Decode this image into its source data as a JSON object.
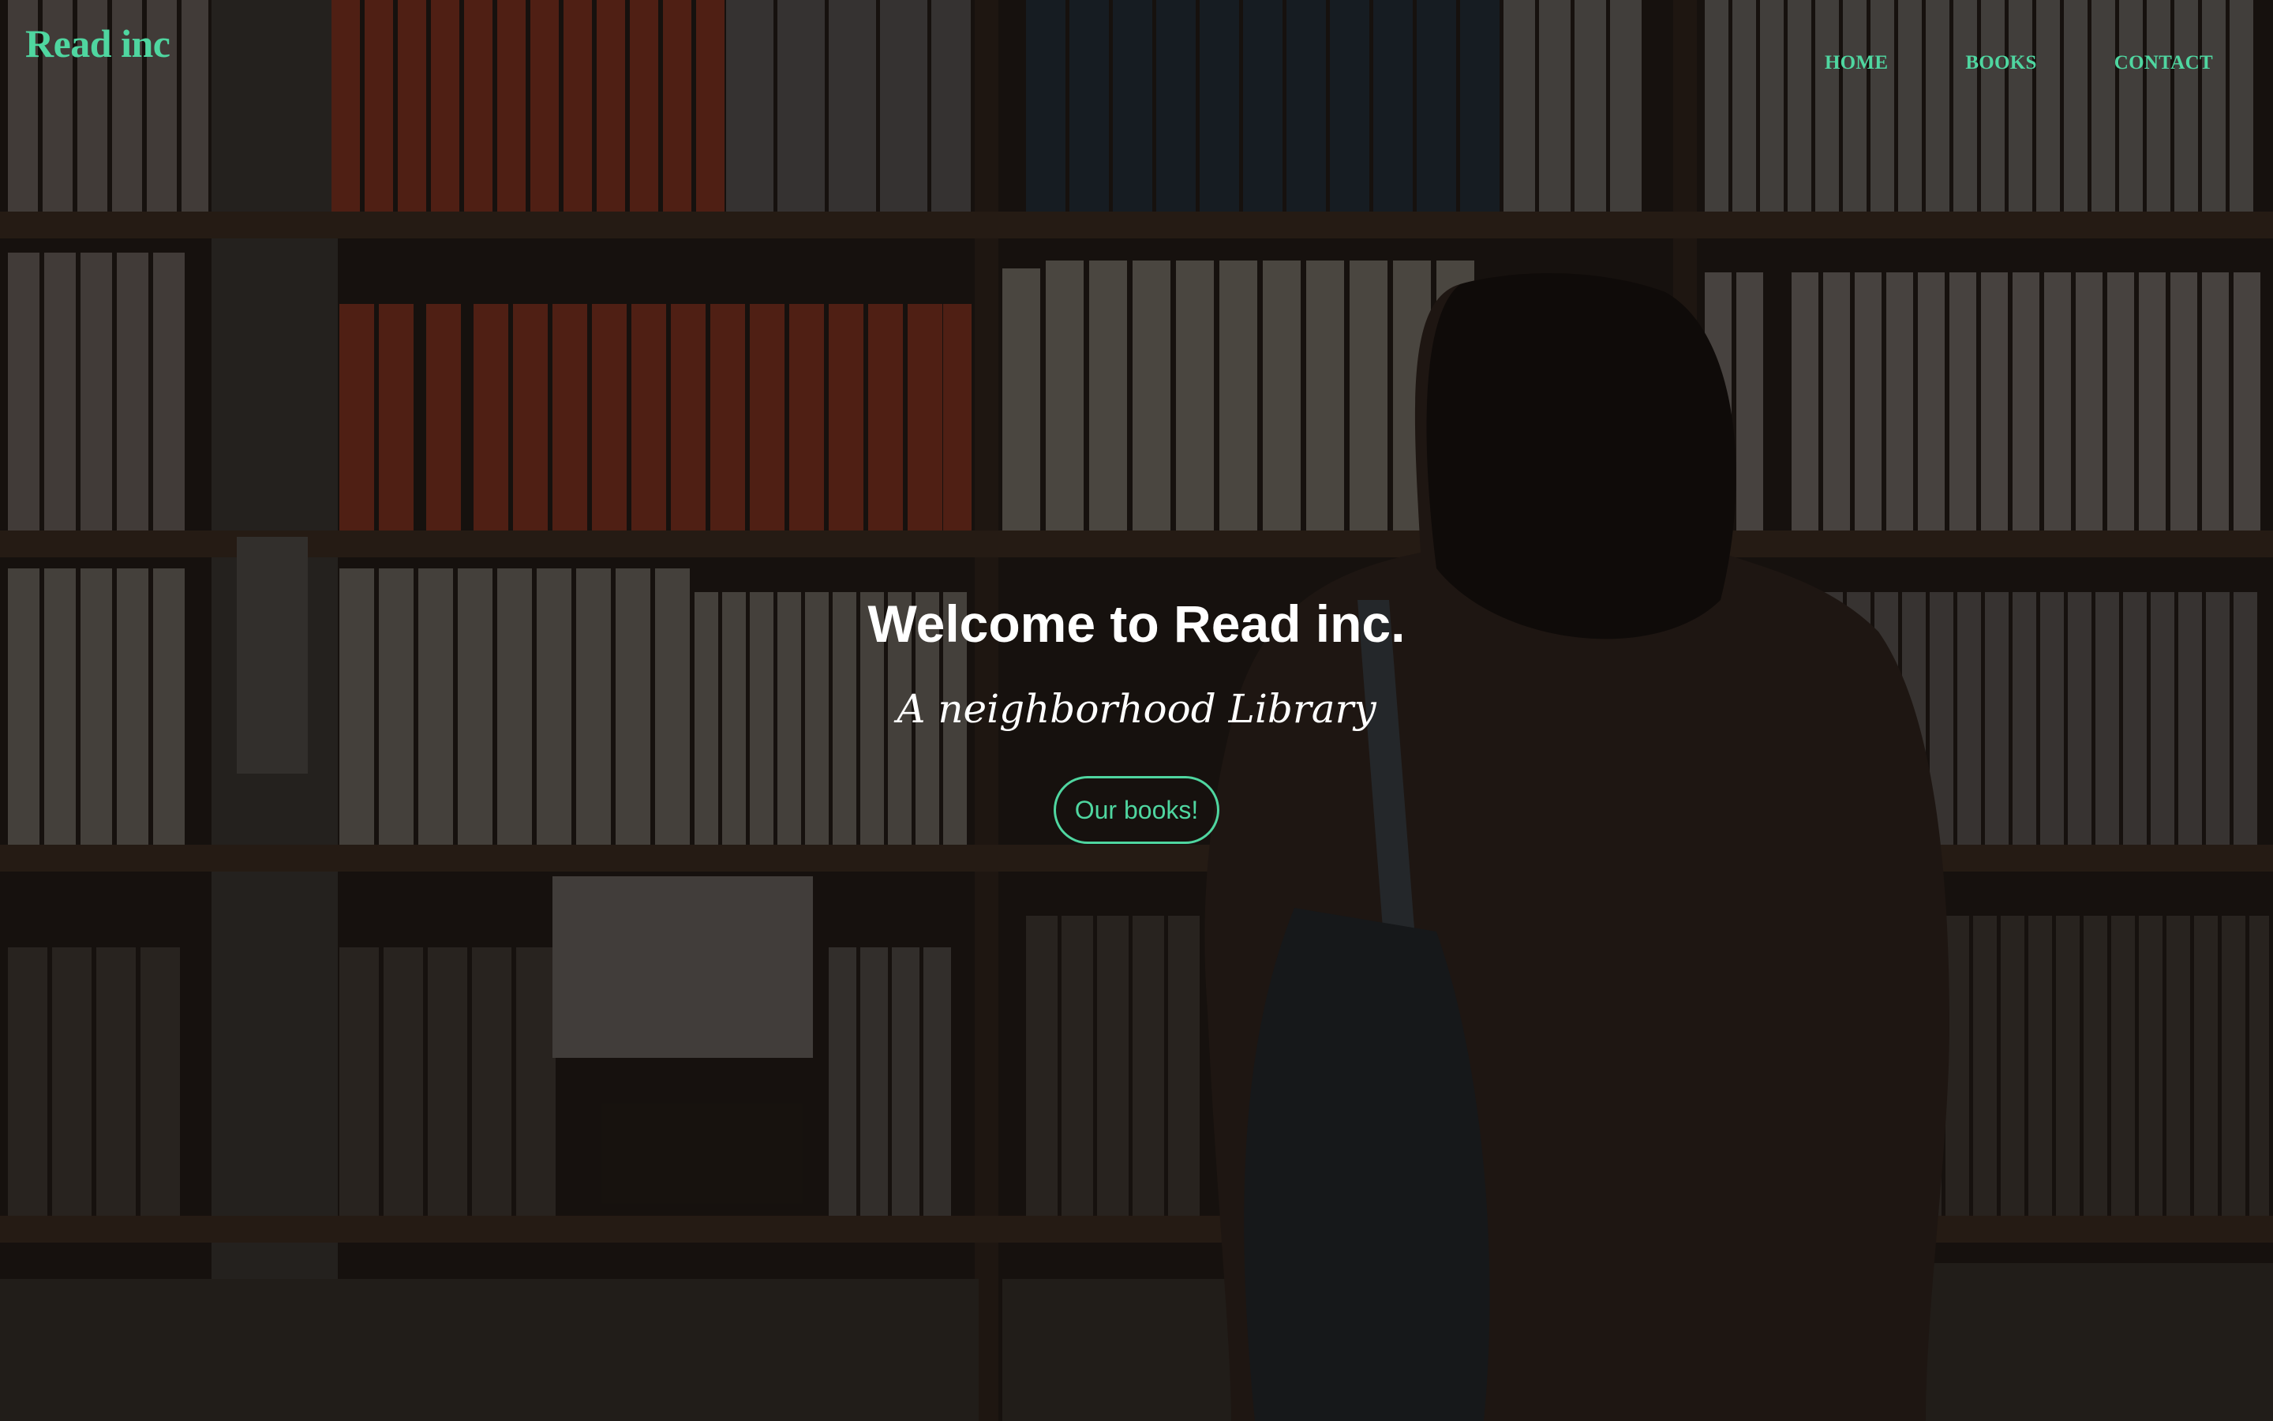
{
  "brand": {
    "name": "Read inc"
  },
  "nav": {
    "items": [
      {
        "label": "HOME"
      },
      {
        "label": "BOOKS"
      },
      {
        "label": "CONTACT"
      }
    ]
  },
  "hero": {
    "headline": "Welcome to Read inc.",
    "tagline": "A neighborhood Library",
    "cta_label": "Our books!",
    "background_image": "bookshelf-with-person-photo"
  },
  "colors": {
    "accent": "#4fd6a0",
    "text": "#ffffff",
    "background": "#0f0c0a"
  }
}
